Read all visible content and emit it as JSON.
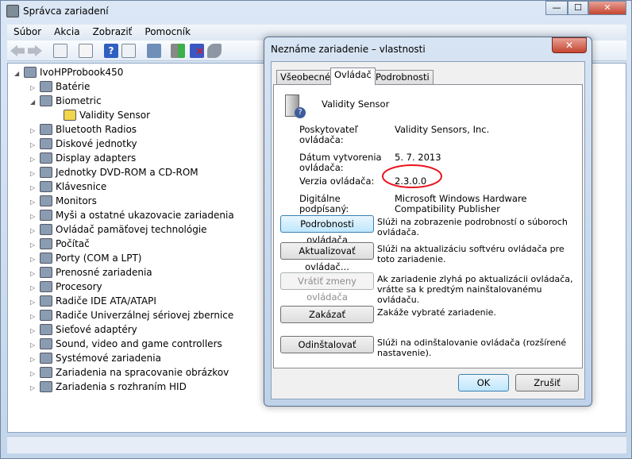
{
  "window": {
    "title": "Správca zariadení",
    "minimize": "—",
    "maximize": "☐",
    "close": "✕"
  },
  "menu": [
    "Súbor",
    "Akcia",
    "Zobraziť",
    "Pomocník"
  ],
  "tree": {
    "root": "IvoHPProbook450",
    "items": [
      {
        "label": "Batérie",
        "exp": "▷"
      },
      {
        "label": "Biometric",
        "exp": "◢"
      },
      {
        "label": "Validity Sensor",
        "child": true
      },
      {
        "label": "Bluetooth Radios",
        "exp": "▷"
      },
      {
        "label": "Diskové jednotky",
        "exp": "▷"
      },
      {
        "label": "Display adapters",
        "exp": "▷"
      },
      {
        "label": "Jednotky DVD-ROM a CD-ROM",
        "exp": "▷"
      },
      {
        "label": "Klávesnice",
        "exp": "▷"
      },
      {
        "label": "Monitors",
        "exp": "▷"
      },
      {
        "label": "Myši a ostatné ukazovacie zariadenia",
        "exp": "▷"
      },
      {
        "label": "Ovládač pamäťovej technológie",
        "exp": "▷"
      },
      {
        "label": "Počítač",
        "exp": "▷"
      },
      {
        "label": "Porty (COM a LPT)",
        "exp": "▷"
      },
      {
        "label": "Prenosné zariadenia",
        "exp": "▷"
      },
      {
        "label": "Procesory",
        "exp": "▷"
      },
      {
        "label": "Radiče IDE ATA/ATAPI",
        "exp": "▷"
      },
      {
        "label": "Radiče Univerzálnej sériovej zbernice",
        "exp": "▷"
      },
      {
        "label": "Sieťové adaptéry",
        "exp": "▷"
      },
      {
        "label": "Sound, video and game controllers",
        "exp": "▷"
      },
      {
        "label": "Systémové zariadenia",
        "exp": "▷"
      },
      {
        "label": "Zariadenia na spracovanie obrázkov",
        "exp": "▷"
      },
      {
        "label": "Zariadenia s rozhraním HID",
        "exp": "▷"
      }
    ]
  },
  "dialog": {
    "title": "Neznáme zariadenie – vlastnosti",
    "close": "✕",
    "tabs": [
      "Všeobecné",
      "Ovládač",
      "Podrobnosti"
    ],
    "device": "Validity Sensor",
    "props": [
      {
        "label": "Poskytovateľ ovládača:",
        "value": "Validity Sensors, Inc."
      },
      {
        "label": "Dátum vytvorenia ovládača:",
        "value": "5. 7. 2013"
      },
      {
        "label": "Verzia ovládača:",
        "value": "2.3.0.0"
      },
      {
        "label": "Digitálne podpísaný:",
        "value": "Microsoft Windows Hardware Compatibility Publisher"
      }
    ],
    "buttons": [
      {
        "label": "Podrobnosti ovládača",
        "desc": "Slúži na zobrazenie podrobností o súboroch ovládača."
      },
      {
        "label": "Aktualizovať ovládač...",
        "desc": "Slúži na aktualizáciu softvéru ovládača pre toto zariadenie."
      },
      {
        "label": "Vrátiť zmeny ovládača",
        "desc": "Ak zariadenie zlyhá po aktualizácii ovládača, vrátte sa k predtým nainštalovanému ovládaču."
      },
      {
        "label": "Zakázať",
        "desc": "Zakáže vybraté zariadenie."
      },
      {
        "label": "Odinštalovať",
        "desc": "Slúži na odinštalovanie ovládača (rozšírené nastavenie)."
      }
    ],
    "ok": "OK",
    "cancel": "Zrušiť"
  },
  "annotation_color": "#e8141e"
}
